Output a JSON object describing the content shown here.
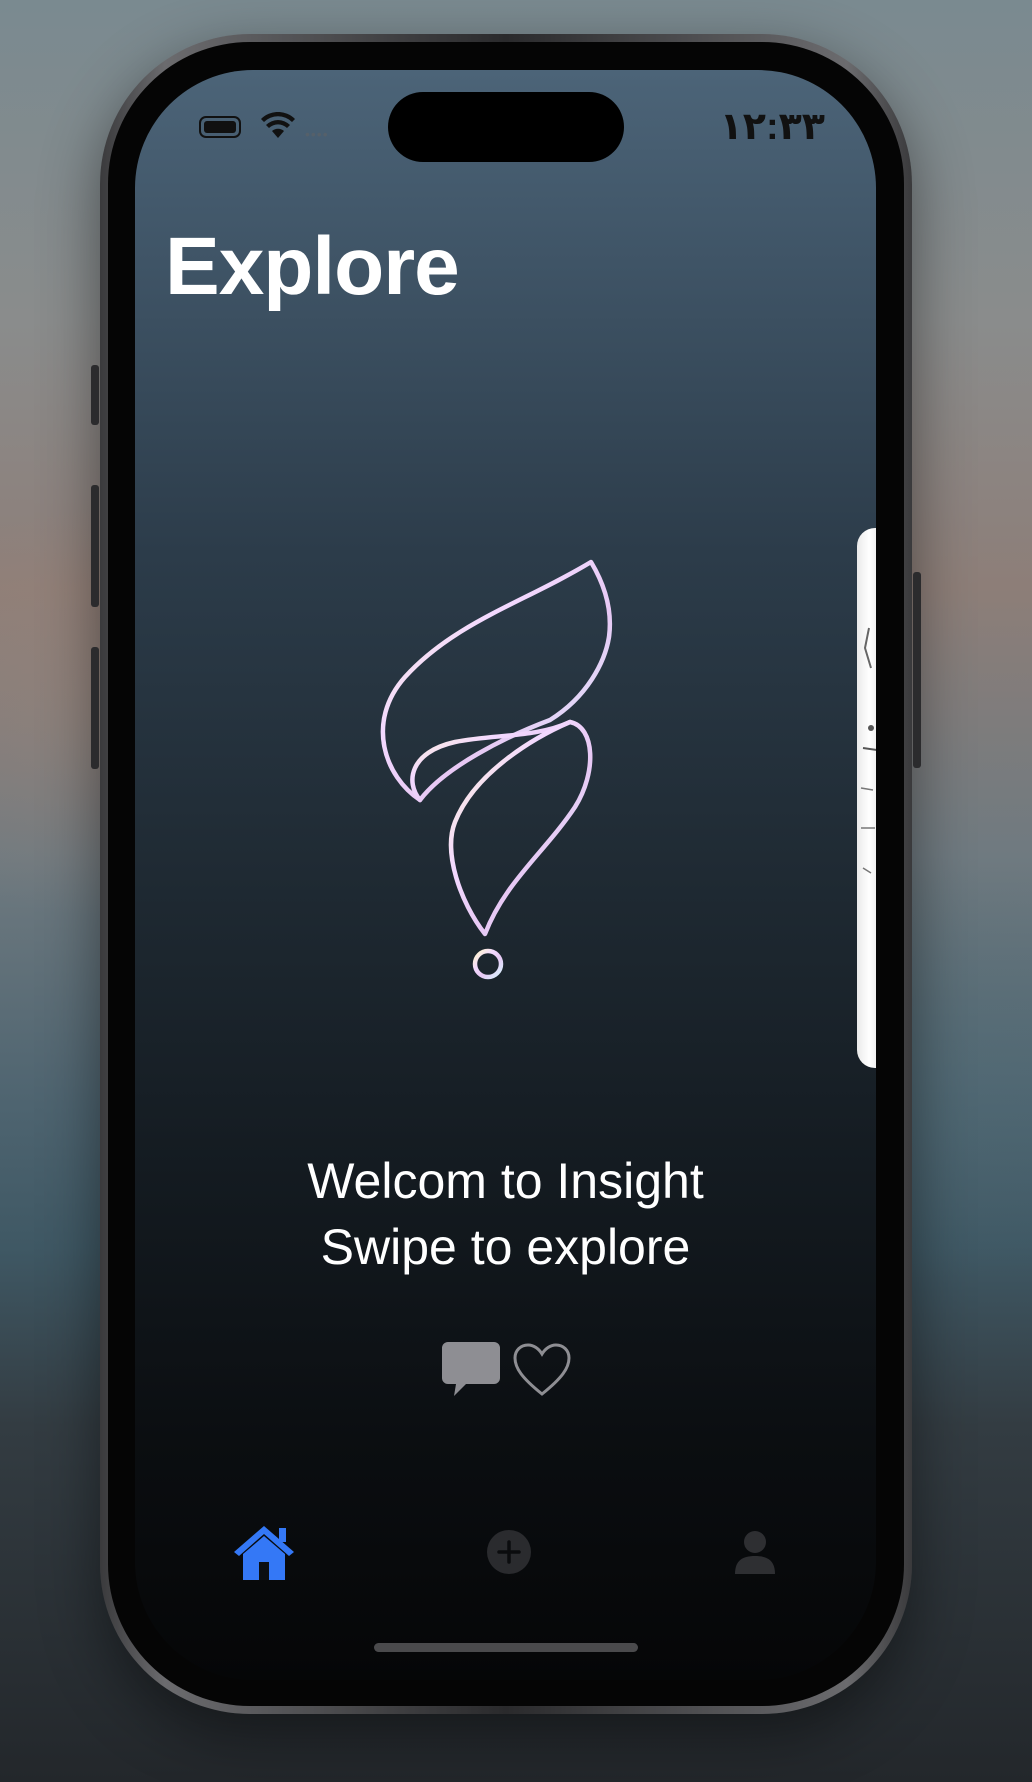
{
  "status_bar": {
    "time": "۱۲:۳۳",
    "signal_dots": "••••"
  },
  "header": {
    "title": "Explore"
  },
  "main": {
    "welcome_line1": "Welcom to Insight",
    "welcome_line2": "Swipe to explore",
    "actions": [
      {
        "icon": "comment-icon"
      },
      {
        "icon": "heart-icon"
      }
    ]
  },
  "tab_bar": {
    "items": [
      {
        "icon": "home-icon",
        "selected": true
      },
      {
        "icon": "add-circle-icon",
        "selected": false
      },
      {
        "icon": "person-icon",
        "selected": false
      }
    ]
  },
  "colors": {
    "accent": "#3478f6",
    "text": "#ffffff",
    "icon_muted": "#8e8e93",
    "tab_inactive": "#3a3a3c"
  }
}
